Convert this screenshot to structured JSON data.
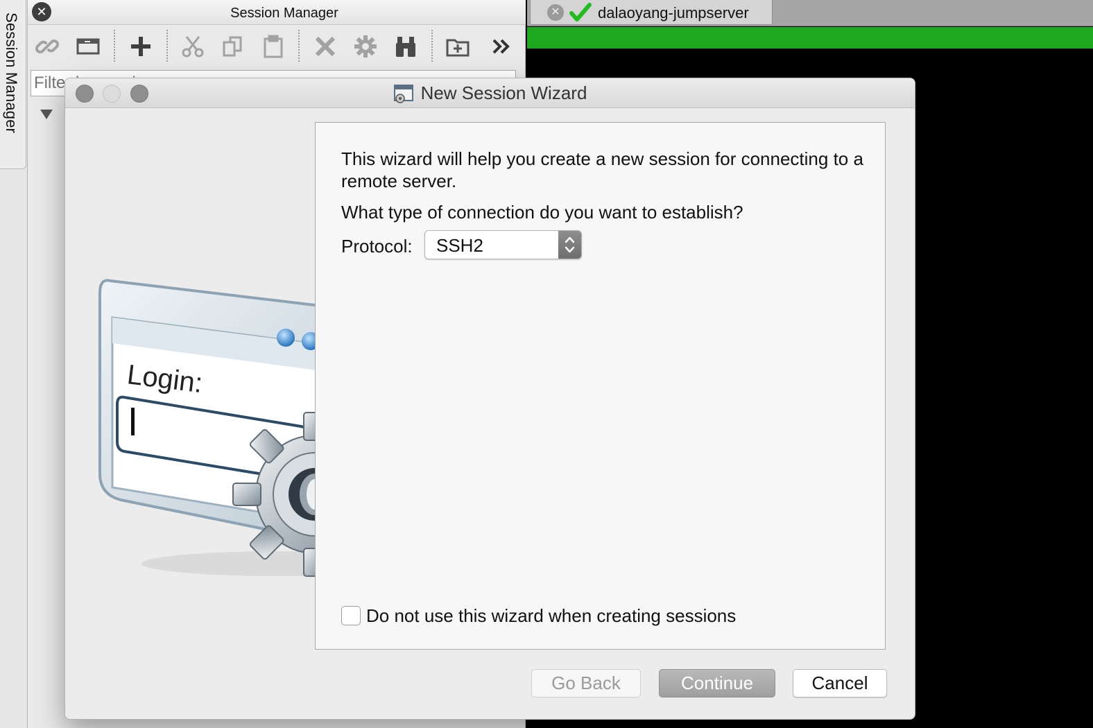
{
  "sidebar": {
    "tab_label": "Session Manager"
  },
  "session_manager": {
    "title": "Session Manager",
    "filter_placeholder": "Filter by session name",
    "toolbar": {
      "icons": [
        "link-icon",
        "new-tab-icon",
        "add-icon",
        "cut-icon",
        "copy-icon",
        "paste-icon",
        "delete-icon",
        "properties-icon",
        "find-icon",
        "new-folder-icon",
        "more-icon"
      ]
    }
  },
  "terminal": {
    "tab_label": "dalaoyang-jumpserver",
    "status_color": "#1ea81e"
  },
  "wizard": {
    "title": "New Session Wizard",
    "intro": "This wizard will help you create a new session for connecting to a remote server.",
    "question": "What type of connection do you want to establish?",
    "protocol_label": "Protocol:",
    "protocol_value": "SSH2",
    "checkbox_label": "Do not use this wizard when creating sessions",
    "checkbox_checked": false,
    "illustration_text": "Login:",
    "buttons": {
      "back": "Go Back",
      "continue": "Continue",
      "cancel": "Cancel"
    }
  }
}
